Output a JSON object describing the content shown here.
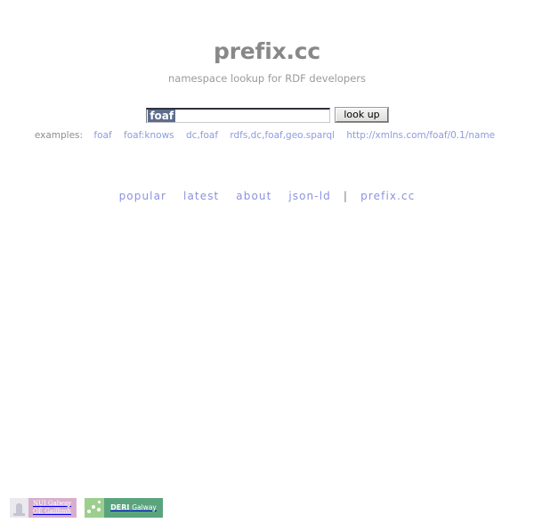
{
  "header": {
    "title": "prefix.cc",
    "tagline": "namespace lookup for RDF developers"
  },
  "search": {
    "value": "foaf",
    "selected": true,
    "selection_color": "#5d6d8c",
    "button_label": "look up"
  },
  "examples": {
    "label": "examples:",
    "items": [
      {
        "text": "foaf"
      },
      {
        "text": "foaf:knows"
      },
      {
        "text": "dc,foaf"
      },
      {
        "text": "rdfs,dc,foaf,geo.sparql"
      },
      {
        "text": "http://xmlns.com/foaf/0.1/name"
      }
    ],
    "link_color": "#8c9ce0"
  },
  "nav": {
    "items": [
      {
        "label": "popular"
      },
      {
        "label": "latest"
      },
      {
        "label": "about"
      },
      {
        "label": "json-ld"
      }
    ],
    "separator": "|",
    "home_label": "prefix.cc",
    "link_color": "#8c93dd"
  },
  "footer": {
    "logos": [
      {
        "name": "nui-galway",
        "line1": "NUI Galway",
        "line2": "OÉ Gaillimh",
        "color": "#d8aecd"
      },
      {
        "name": "deri-galway",
        "line1": "DERI",
        "line2": "Galway",
        "color": "#5aa47d"
      }
    ]
  }
}
